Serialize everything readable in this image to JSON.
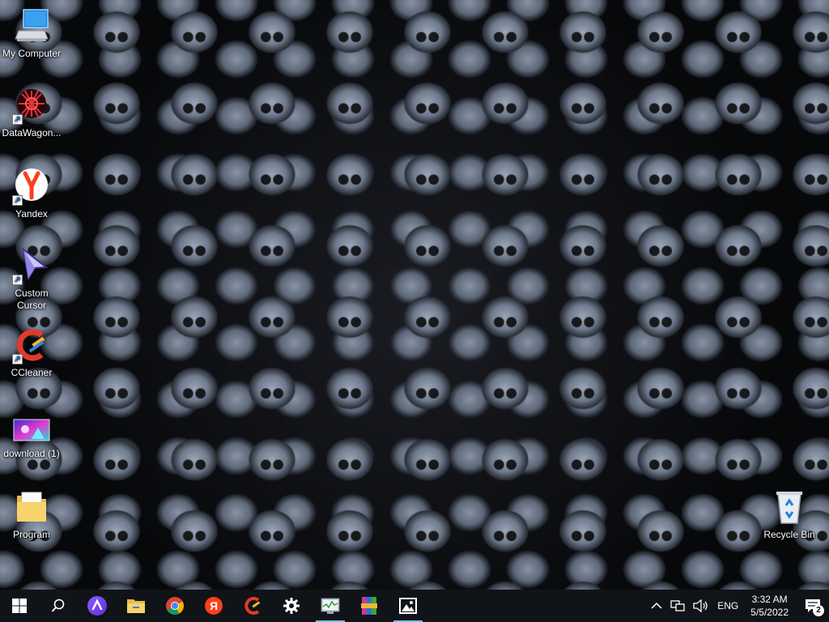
{
  "desktop": {
    "icons": [
      {
        "label": "My Computer"
      },
      {
        "label": "DataWagon..."
      },
      {
        "label": "Yandex"
      },
      {
        "label": "Custom\nCursor"
      },
      {
        "label": "CCleaner"
      },
      {
        "label": "download (1)"
      },
      {
        "label": "Program"
      },
      {
        "label": "Recycle Bin"
      }
    ]
  },
  "taskbar": {
    "apps": [
      {
        "icon": "windows-start-icon"
      },
      {
        "icon": "search-icon"
      },
      {
        "icon": "alice-assistant-icon"
      },
      {
        "icon": "file-explorer-icon"
      },
      {
        "icon": "chrome-icon"
      },
      {
        "icon": "yandex-browser-icon"
      },
      {
        "icon": "ccleaner-icon"
      },
      {
        "icon": "settings-gear-icon"
      },
      {
        "icon": "task-manager-icon"
      },
      {
        "icon": "winrar-icon"
      },
      {
        "icon": "photos-icon"
      }
    ],
    "tray": {
      "language": "ENG",
      "time": "3:32 AM",
      "date": "5/5/2022",
      "notification_count": "2"
    }
  },
  "colors": {
    "taskbar_bg": "#101317",
    "running_indicator": "#76b9ed"
  }
}
